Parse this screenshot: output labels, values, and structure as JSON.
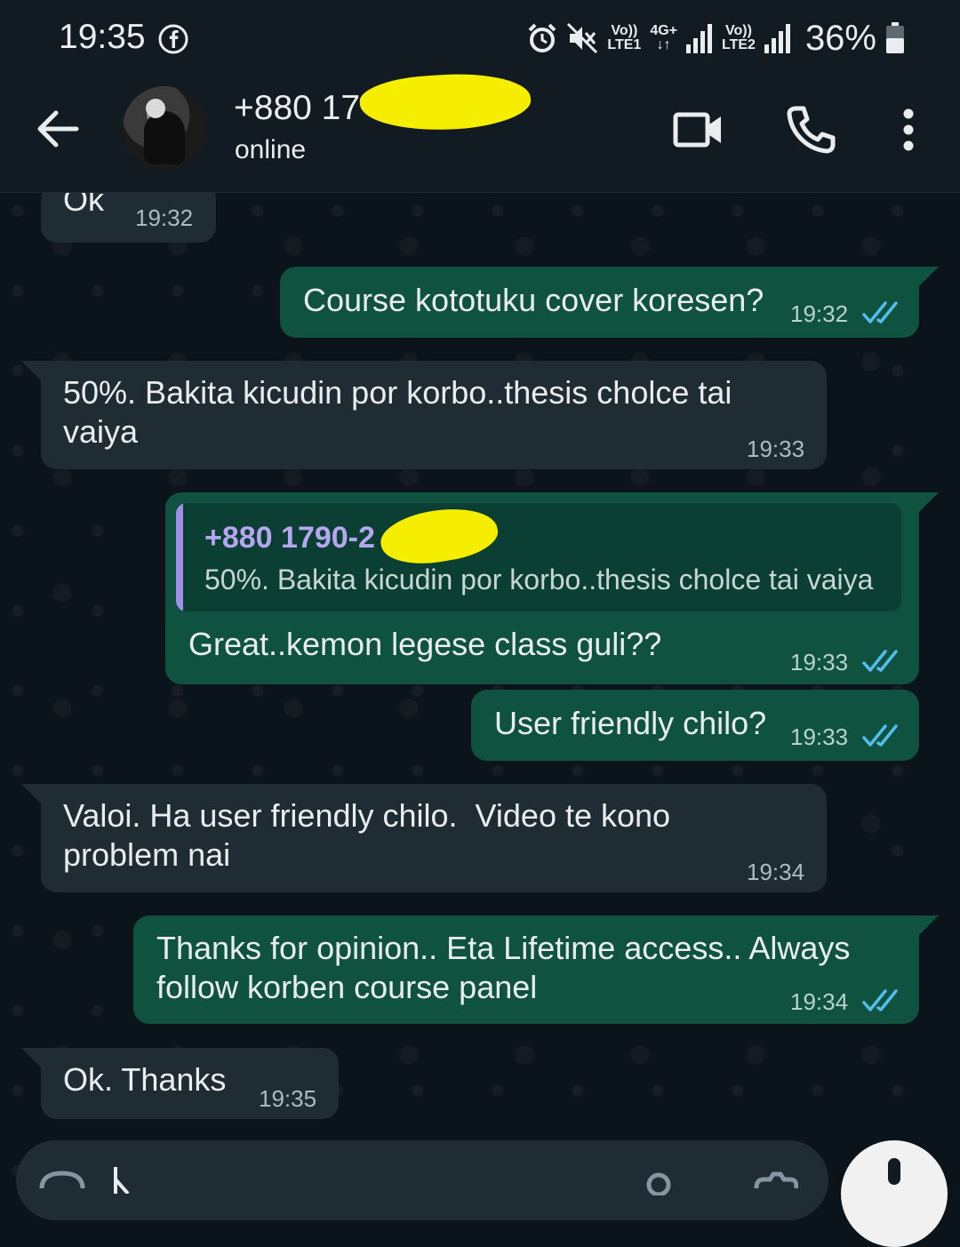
{
  "status_bar": {
    "time": "19:35",
    "sim1_top": "Vo))",
    "sim1_bottom": "LTE1",
    "net_top": "4G+",
    "net_bottom": "↓↑",
    "sim2_top": "Vo))",
    "sim2_bottom": "LTE2",
    "battery": "36%",
    "icons": [
      "facebook-icon",
      "alarm-icon",
      "mute-icon",
      "signal-icon",
      "battery-icon"
    ]
  },
  "header": {
    "contact_name": "+880 17",
    "status": "online",
    "icons": [
      "back-arrow-icon",
      "video-call-icon",
      "phone-icon",
      "more-vertical-icon"
    ]
  },
  "messages": [
    {
      "dir": "in",
      "text": "Ok",
      "time": "19:32"
    },
    {
      "dir": "out",
      "text": "Course kototuku cover koresen?",
      "time": "19:32"
    },
    {
      "dir": "in",
      "text_line1": "50%. Bakita kicudin por korbo..thesis cholce tai",
      "text_line2": "vaiya",
      "time": "19:33"
    },
    {
      "dir": "out",
      "quote_name": "+880 1790-2",
      "quote_text": "50%. Bakita kicudin por korbo..thesis cholce tai vaiya",
      "text": "Great..kemon legese class guli??",
      "time": "19:33"
    },
    {
      "dir": "out",
      "text": "User friendly chilo?",
      "time": "19:33"
    },
    {
      "dir": "in",
      "text_line1": "Valoi. Ha user friendly chilo.  Video te kono",
      "text_line2": "problem nai",
      "time": "19:34"
    },
    {
      "dir": "out",
      "text_line1": "Thanks for opinion.. Eta Lifetime access.. Always",
      "text_line2": "follow korben course panel",
      "time": "19:34"
    },
    {
      "dir": "in",
      "text": "Ok. Thanks",
      "time": "19:35"
    }
  ],
  "colors": {
    "background": "#0b141a",
    "incoming_bubble": "#202c33",
    "outgoing_bubble": "#0f5240",
    "read_ticks": "#53bdeb",
    "quote_accent": "#a08fe6",
    "redaction": "#f6ee00"
  }
}
